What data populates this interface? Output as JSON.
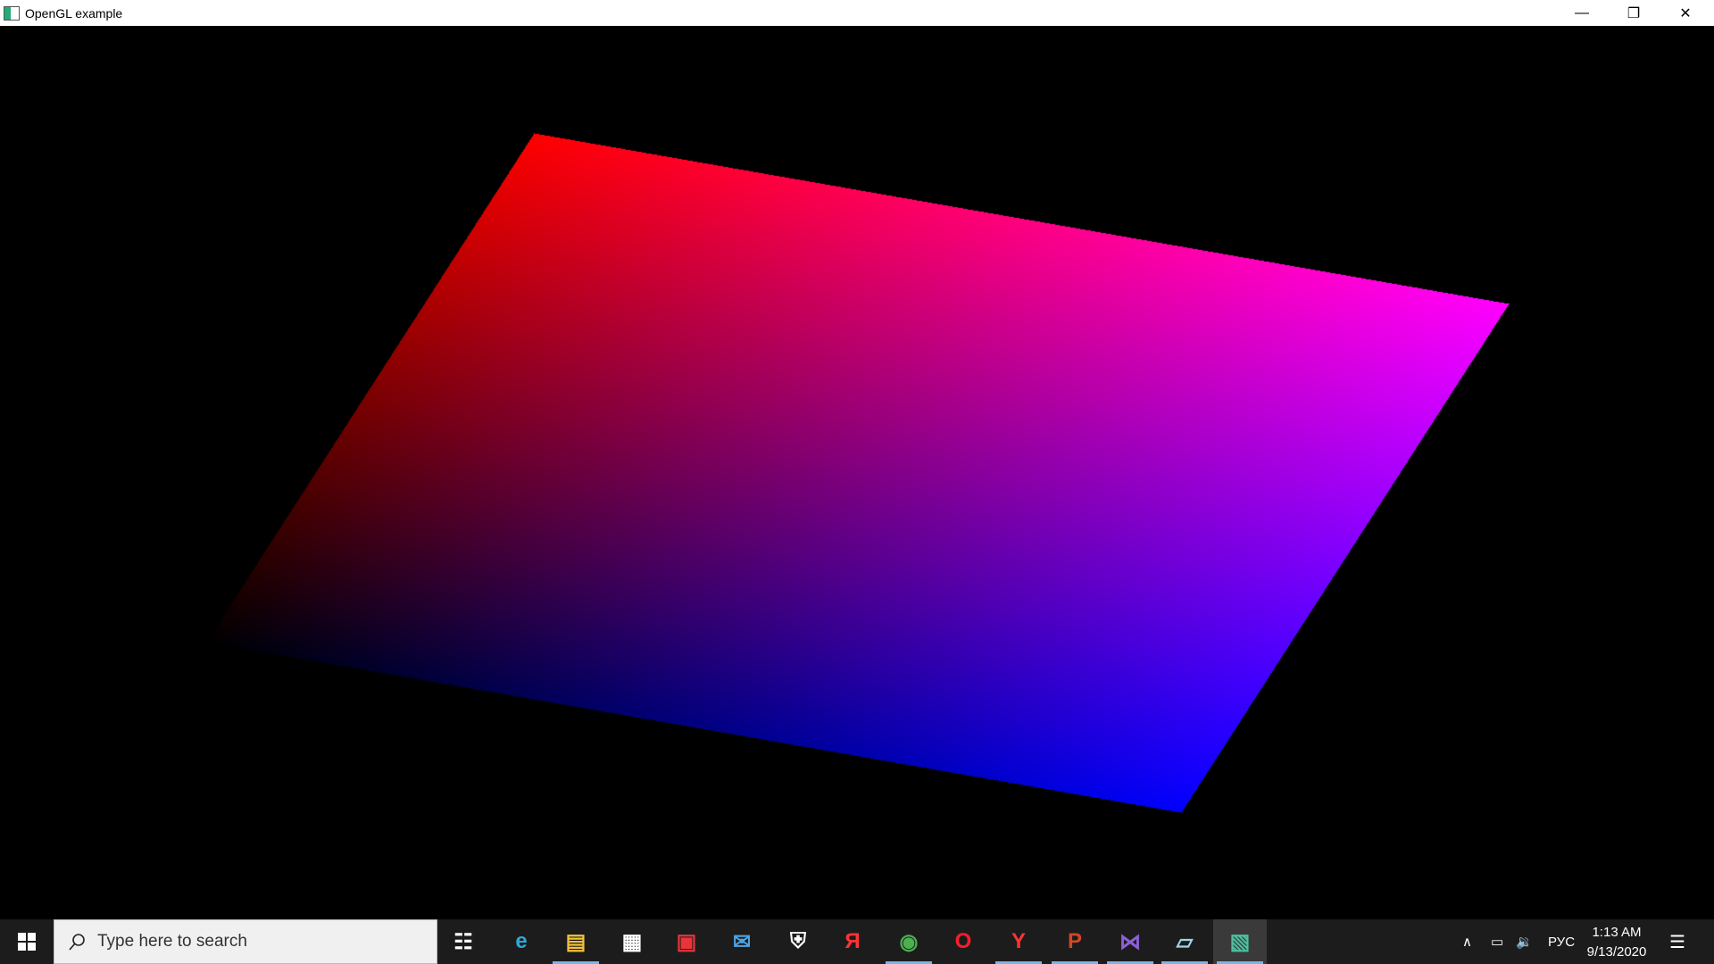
{
  "window": {
    "title": "OpenGL example",
    "minimize": "—",
    "restore": "❐",
    "close": "✕"
  },
  "scene": {
    "corner_colors": {
      "top_left": "#ff0000",
      "top_right": "#ff00ff",
      "bottom_right": "#0000ff",
      "bottom_left": "#000000"
    },
    "background": "#000000"
  },
  "taskbar": {
    "search_placeholder": "Type here to search",
    "apps": [
      {
        "name": "task-view",
        "glyph": "☷",
        "color": "#ffffff",
        "running": false
      },
      {
        "name": "edge",
        "glyph": "e",
        "color": "#2fa8d8",
        "running": false
      },
      {
        "name": "file-explorer",
        "glyph": "▤",
        "color": "#f2c23c",
        "running": true
      },
      {
        "name": "store",
        "glyph": "▦",
        "color": "#ffffff",
        "running": false
      },
      {
        "name": "gift",
        "glyph": "▣",
        "color": "#e8343a",
        "running": false
      },
      {
        "name": "mail",
        "glyph": "✉",
        "color": "#4fa3e3",
        "running": false
      },
      {
        "name": "security",
        "glyph": "⛨",
        "color": "#ffffff",
        "running": false
      },
      {
        "name": "yandex",
        "glyph": "Я",
        "color": "#ff3333",
        "running": false
      },
      {
        "name": "chrome",
        "glyph": "◉",
        "color": "#4caf50",
        "running": true
      },
      {
        "name": "opera",
        "glyph": "O",
        "color": "#ff1b2d",
        "running": false
      },
      {
        "name": "yandex-browser",
        "glyph": "Y",
        "color": "#ff3333",
        "running": true
      },
      {
        "name": "powerpoint",
        "glyph": "P",
        "color": "#d24726",
        "running": true
      },
      {
        "name": "visual-studio",
        "glyph": "⋈",
        "color": "#8e5fd8",
        "running": true
      },
      {
        "name": "notepad",
        "glyph": "▱",
        "color": "#9fd4e8",
        "running": true
      },
      {
        "name": "opengl-app",
        "glyph": "▧",
        "color": "#4cc0a0",
        "running": true,
        "active": true
      }
    ],
    "tray": {
      "chevron": "∧",
      "battery": "▭",
      "volume": "🔉",
      "language": "РУС"
    },
    "time": "1:13 AM",
    "date": "9/13/2020",
    "notifications": "☰"
  }
}
